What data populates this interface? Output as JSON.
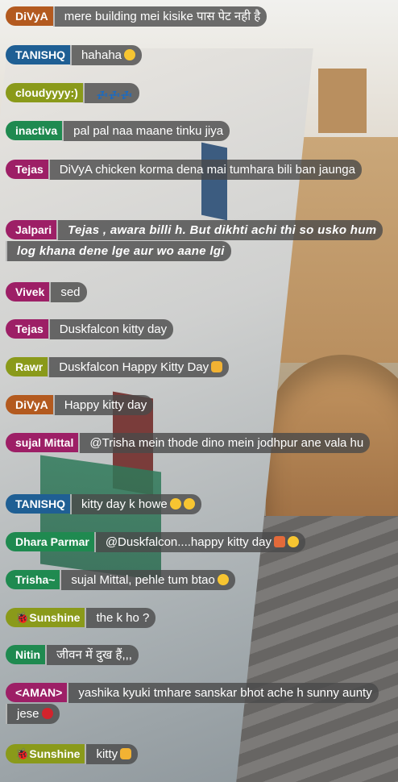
{
  "colors": {
    "orange": "#b35a1f",
    "blue": "#1f5f94",
    "olive": "#8a9a1a",
    "green": "#1f8a50",
    "magenta": "#9d1f66",
    "bubble": "#4a4a4a"
  },
  "messages": [
    {
      "user": "DiVyA",
      "text": "mere building mei kisike पास पेट नही है"
    },
    {
      "user": "TANISHQ",
      "text": "hahaha",
      "emoji": "slight-smile"
    },
    {
      "user": "cloudyyyy:)",
      "text": "💤💤💤"
    },
    {
      "user": "inactiva",
      "text": "pal pal naa maane tinku jiya"
    },
    {
      "user": "Tejas",
      "text": "DiVyA chicken korma dena mai tumhara bili ban jaunga"
    },
    {
      "user": "Jalpari",
      "text": "Tejas , awara billi h. But dikhti achi thi so usko hum log khana dene lge aur wo aane lgi"
    },
    {
      "user": "Vivek",
      "text": "sed"
    },
    {
      "user": "Tejas",
      "text": "Duskfalcon kitty day"
    },
    {
      "user": "Rawr",
      "text": "Duskfalcon Happy Kitty Day",
      "emoji": "cat"
    },
    {
      "user": "DiVyA",
      "text": "Happy kitty day"
    },
    {
      "user": "sujal Mittal",
      "text": "@Trisha mein thode dino mein jodhpur ane vala hu"
    },
    {
      "user": "TANISHQ",
      "text": "kitty day k howe",
      "emoji": "smile-nerd"
    },
    {
      "user": "Dhara Parmar",
      "text": "@Duskfalcon....happy kitty day",
      "emoji": "party-smile"
    },
    {
      "user": "Trisha~",
      "text": "sujal Mittal, pehle tum btao",
      "emoji": "hug"
    },
    {
      "user": "🐞Sunshine",
      "text": "the k ho ?"
    },
    {
      "user": "Nitin",
      "text": "जीवन में दुख हैं,,,"
    },
    {
      "user": "<AMAN>",
      "text": "yashika kyuki tmhare sanskar bhot ache h sunny aunty jese",
      "emoji": "red-face"
    },
    {
      "user": "🐞Sunshine",
      "text": "kitty",
      "emoji": "cat-face"
    }
  ]
}
